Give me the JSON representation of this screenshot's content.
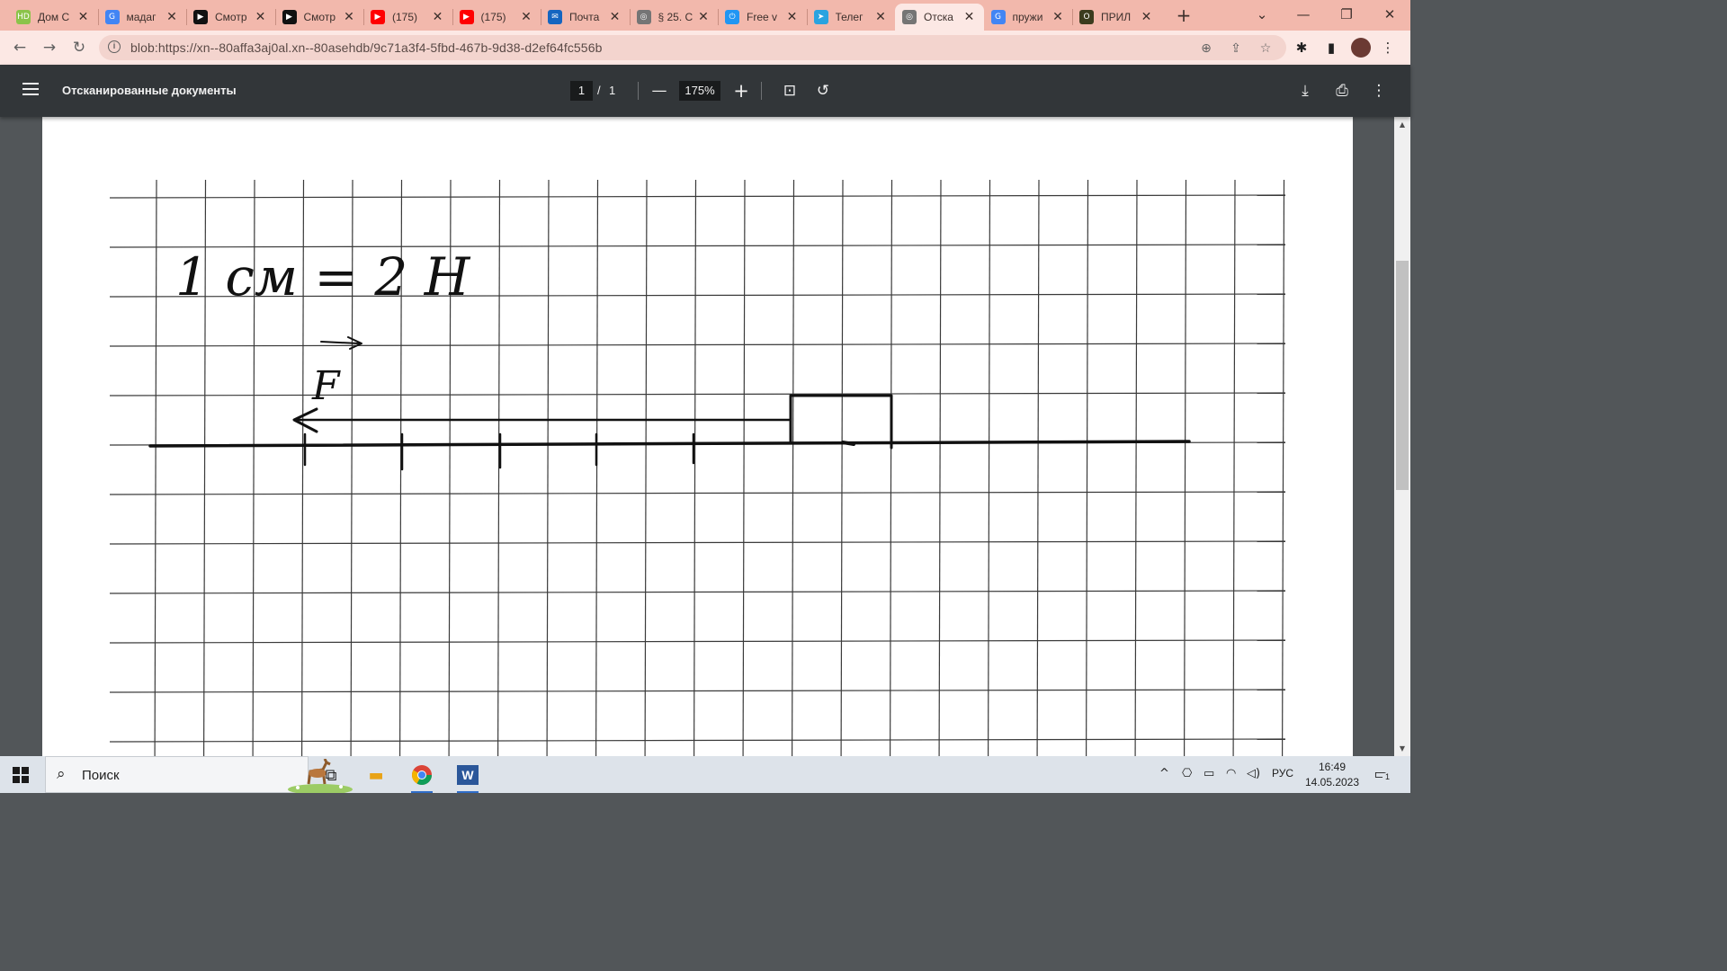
{
  "browser": {
    "tabs": [
      {
        "icon": "hd-icon",
        "icon_label": "HD",
        "icon_color": "#8bc34a",
        "title": "Дом С",
        "close": "✕"
      },
      {
        "icon": "google-icon",
        "icon_label": "G",
        "icon_color": "#4285f4",
        "title": "мадаг",
        "close": "✕"
      },
      {
        "icon": "play-icon",
        "icon_label": "▶",
        "icon_color": "#111111",
        "title": "Смотр",
        "close": "✕"
      },
      {
        "icon": "play-icon",
        "icon_label": "▶",
        "icon_color": "#111111",
        "title": "Смотр",
        "close": "✕"
      },
      {
        "icon": "youtube-icon",
        "icon_label": "▶",
        "icon_color": "#ff0000",
        "title": "(175)",
        "close": "✕"
      },
      {
        "icon": "youtube-icon",
        "icon_label": "▶",
        "icon_color": "#ff0000",
        "title": "(175)",
        "close": "✕"
      },
      {
        "icon": "mail-icon",
        "icon_label": "✉",
        "icon_color": "#1565c0",
        "title": "Почта",
        "close": "✕"
      },
      {
        "icon": "globe-icon",
        "icon_label": "◎",
        "icon_color": "#757575",
        "title": "§ 25. С",
        "close": "✕"
      },
      {
        "icon": "power-icon",
        "icon_label": "⏻",
        "icon_color": "#2196f3",
        "title": "Free v",
        "close": "✕"
      },
      {
        "icon": "telegram-icon",
        "icon_label": "➤",
        "icon_color": "#2aa3e0",
        "title": "Телег",
        "close": "✕"
      },
      {
        "icon": "globe-icon",
        "icon_label": "◎",
        "icon_color": "#757575",
        "title": "Отска",
        "close": "✕",
        "active": true
      },
      {
        "icon": "google-icon",
        "icon_label": "G",
        "icon_color": "#4285f4",
        "title": "пружи",
        "close": "✕"
      },
      {
        "icon": "app-icon",
        "icon_label": "O",
        "icon_color": "#3c3c1e",
        "title": "ПРИЛ",
        "close": "✕"
      }
    ],
    "new_tab": "+",
    "window_controls": {
      "tab_search": "⌄",
      "minimize": "—",
      "restore": "❐",
      "close": "✕"
    },
    "nav": {
      "back": "←",
      "forward": "→",
      "reload": "↻"
    },
    "url": "blob:https://xn--80affa3aj0al.xn--80asehdb/9c71a3f4-5fbd-467b-9d38-d2ef64fc556b",
    "omnibox_icons": {
      "zoom": "⊕",
      "share": "⇪",
      "bookmark": "☆"
    },
    "toolbar_icons": {
      "extensions": "✱",
      "sidepanel": "▮",
      "menu": "⋮"
    }
  },
  "pdf_viewer": {
    "title": "Отсканированные документы",
    "current_page": "1",
    "page_separator": "/",
    "total_pages": "1",
    "zoom": "175%",
    "zoom_out": "—",
    "zoom_in": "+",
    "fit_icon": "⊡",
    "rotate_icon": "↺",
    "download_icon": "⤓",
    "print_icon": "⎙",
    "more_icon": "⋮"
  },
  "handwriting": {
    "scale": "1 см = 2 Н",
    "force_label": "F"
  },
  "taskbar": {
    "search_placeholder": "Поиск",
    "search_icon": "⌕",
    "taskview_icon": "⧉",
    "explorer_icon": "▬",
    "word_icon": "W",
    "tray_up": "^",
    "tray_meet": "⎔",
    "tray_battery": "▭",
    "tray_wifi": "◠",
    "tray_volume": "◁)",
    "language": "РУС",
    "time": "16:49",
    "date": "14.05.2023",
    "notifications": "1"
  },
  "colors": {
    "tab_strip": "#f2b8ac",
    "toolbar": "#fce8e4",
    "pdf_toolbar": "#323639",
    "viewer_bg": "#525659",
    "taskbar": "#dde3ea"
  }
}
